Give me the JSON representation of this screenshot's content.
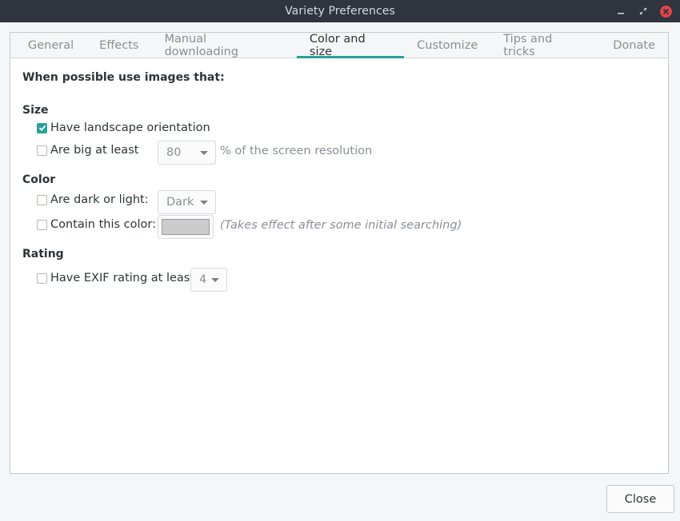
{
  "window": {
    "title": "Variety Preferences",
    "minimize_icon": "minimize-icon",
    "maximize_icon": "maximize-icon",
    "close_icon": "close-icon",
    "close_color": "#e2434a"
  },
  "tabs": [
    {
      "label": "General",
      "active": false
    },
    {
      "label": "Effects",
      "active": false
    },
    {
      "label": "Manual downloading",
      "active": false
    },
    {
      "label": "Color and size",
      "active": true
    },
    {
      "label": "Customize",
      "active": false
    },
    {
      "label": "Tips and tricks",
      "active": false
    },
    {
      "label": "Donate",
      "active": false
    }
  ],
  "accent_color": "#2aa198",
  "intro": "When possible use images that:",
  "size": {
    "heading": "Size",
    "landscape": {
      "label": "Have landscape orientation",
      "checked": true
    },
    "big": {
      "label": "Are big at least",
      "checked": false,
      "value": "80",
      "suffix": "% of the screen resolution"
    }
  },
  "color": {
    "heading": "Color",
    "dark_light": {
      "label": "Are dark or light:",
      "checked": false,
      "value": "Dark"
    },
    "contain": {
      "label": "Contain this color:",
      "checked": false,
      "swatch": "#cccccc",
      "note": "(Takes effect after some initial searching)"
    }
  },
  "rating": {
    "heading": "Rating",
    "exif": {
      "label": "Have EXIF rating at least",
      "checked": false,
      "value": "4"
    }
  },
  "footer": {
    "close_label": "Close"
  }
}
